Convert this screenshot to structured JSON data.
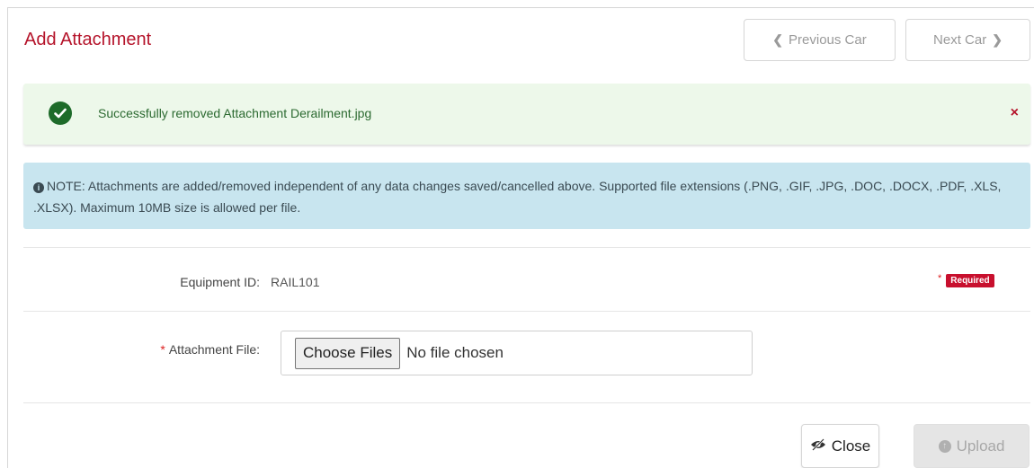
{
  "dialog": {
    "title": "Add Attachment",
    "prev_label": "Previous Car",
    "next_label": "Next Car"
  },
  "success_alert": {
    "message": "Successfully removed Attachment Derailment.jpg",
    "close_glyph": "×",
    "icon": "check-circle-icon",
    "color": "#1e6b2a"
  },
  "info_alert": {
    "icon": "info-circle-icon",
    "text": "NOTE: Attachments are added/removed independent of any data changes saved/cancelled above. Supported file extensions (.PNG, .GIF, .JPG, .DOC, .DOCX, .PDF, .XLS, .XLSX). Maximum 10MB size is allowed per file."
  },
  "form": {
    "equipment_label": "Equipment ID:",
    "equipment_value": "RAIL101",
    "required_star": "*",
    "required_badge": "Required",
    "file_star": "*",
    "file_label": "Attachment File:",
    "choose_button": "Choose Files",
    "no_file_text": "No file chosen"
  },
  "footer": {
    "close_label": "Close",
    "upload_label": "Upload"
  },
  "colors": {
    "title": "#b5142b",
    "success_bg": "#edf8ea",
    "info_bg": "#c8e5ef",
    "required_badge": "#c8102e"
  }
}
